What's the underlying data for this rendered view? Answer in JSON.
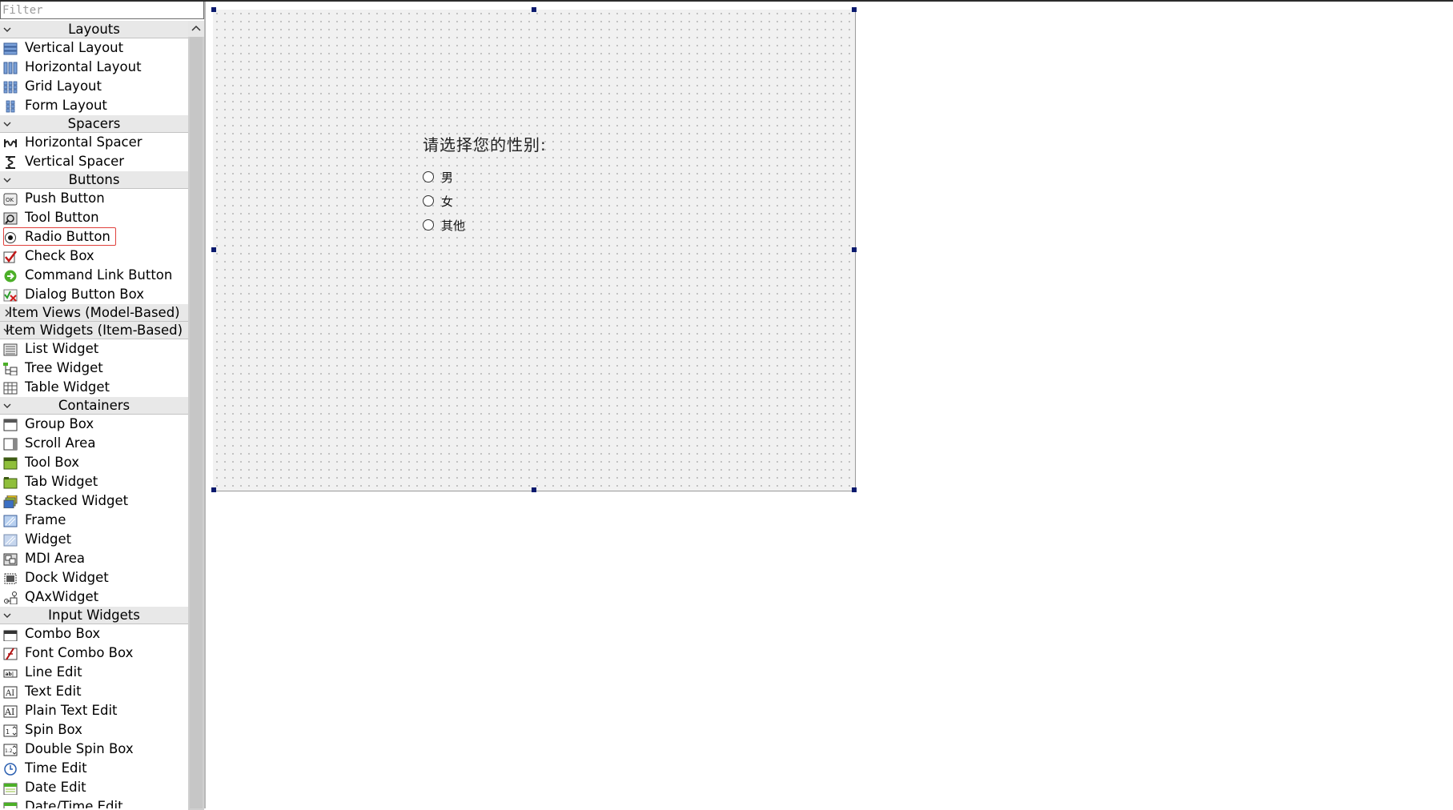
{
  "widget_box": {
    "filter_placeholder": "Filter",
    "categories": [
      {
        "label": "Layouts",
        "expanded": true,
        "items": [
          {
            "label": "Vertical Layout",
            "icon": "vertical-layout-icon"
          },
          {
            "label": "Horizontal Layout",
            "icon": "horizontal-layout-icon"
          },
          {
            "label": "Grid Layout",
            "icon": "grid-layout-icon"
          },
          {
            "label": "Form Layout",
            "icon": "form-layout-icon"
          }
        ]
      },
      {
        "label": "Spacers",
        "expanded": true,
        "items": [
          {
            "label": "Horizontal Spacer",
            "icon": "horizontal-spacer-icon"
          },
          {
            "label": "Vertical Spacer",
            "icon": "vertical-spacer-icon"
          }
        ]
      },
      {
        "label": "Buttons",
        "expanded": true,
        "items": [
          {
            "label": "Push Button",
            "icon": "push-button-icon"
          },
          {
            "label": "Tool Button",
            "icon": "tool-button-icon"
          },
          {
            "label": "Radio Button",
            "icon": "radio-button-icon",
            "selected": true
          },
          {
            "label": "Check Box",
            "icon": "check-box-icon"
          },
          {
            "label": "Command Link Button",
            "icon": "command-link-icon"
          },
          {
            "label": "Dialog Button Box",
            "icon": "dialog-button-box-icon"
          }
        ]
      },
      {
        "label": "Item Views (Model-Based)",
        "expanded": false,
        "items": []
      },
      {
        "label": "Item Widgets (Item-Based)",
        "expanded": true,
        "items": [
          {
            "label": "List Widget",
            "icon": "list-widget-icon"
          },
          {
            "label": "Tree Widget",
            "icon": "tree-widget-icon"
          },
          {
            "label": "Table Widget",
            "icon": "table-widget-icon"
          }
        ]
      },
      {
        "label": "Containers",
        "expanded": true,
        "items": [
          {
            "label": "Group Box",
            "icon": "group-box-icon"
          },
          {
            "label": "Scroll Area",
            "icon": "scroll-area-icon"
          },
          {
            "label": "Tool Box",
            "icon": "tool-box-icon"
          },
          {
            "label": "Tab Widget",
            "icon": "tab-widget-icon"
          },
          {
            "label": "Stacked Widget",
            "icon": "stacked-widget-icon"
          },
          {
            "label": "Frame",
            "icon": "frame-icon"
          },
          {
            "label": "Widget",
            "icon": "widget-icon"
          },
          {
            "label": "MDI Area",
            "icon": "mdi-area-icon"
          },
          {
            "label": "Dock Widget",
            "icon": "dock-widget-icon"
          },
          {
            "label": "QAxWidget",
            "icon": "qaxwidget-icon"
          }
        ]
      },
      {
        "label": "Input Widgets",
        "expanded": true,
        "items": [
          {
            "label": "Combo Box",
            "icon": "combo-box-icon"
          },
          {
            "label": "Font Combo Box",
            "icon": "font-combo-box-icon"
          },
          {
            "label": "Line Edit",
            "icon": "line-edit-icon"
          },
          {
            "label": "Text Edit",
            "icon": "text-edit-icon"
          },
          {
            "label": "Plain Text Edit",
            "icon": "plain-text-edit-icon"
          },
          {
            "label": "Spin Box",
            "icon": "spin-box-icon"
          },
          {
            "label": "Double Spin Box",
            "icon": "double-spin-box-icon"
          },
          {
            "label": "Time Edit",
            "icon": "time-edit-icon"
          },
          {
            "label": "Date Edit",
            "icon": "date-edit-icon"
          },
          {
            "label": "Date/Time Edit",
            "icon": "date-time-edit-icon"
          }
        ]
      }
    ]
  },
  "form": {
    "question": "请选择您的性别:",
    "options": [
      "男",
      "女",
      "其他"
    ]
  },
  "colors": {
    "selection_outline": "#e0403c",
    "handle": "#0a1a6e",
    "category_bg": "#e8e8e8",
    "canvas_bg": "#f1f1f1"
  }
}
